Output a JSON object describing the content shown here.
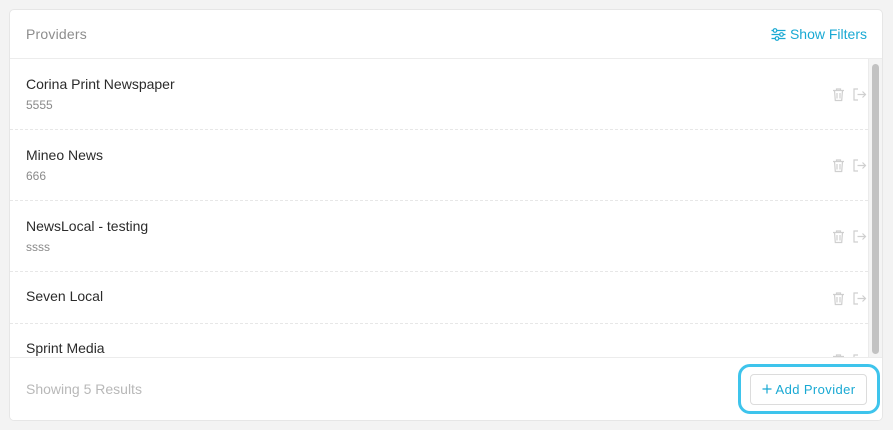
{
  "panel": {
    "title": "Providers",
    "filters_label": "Show Filters",
    "filters_icon": "sliders-icon"
  },
  "providers": [
    {
      "name": "Corina Print Newspaper",
      "sub": "5555"
    },
    {
      "name": "Mineo News",
      "sub": "666"
    },
    {
      "name": "NewsLocal - testing",
      "sub": "ssss"
    },
    {
      "name": "Seven Local",
      "sub": ""
    },
    {
      "name": "Sprint Media",
      "sub": ""
    }
  ],
  "row_actions": {
    "delete_icon": "trash-icon",
    "open_icon": "sign-out-icon"
  },
  "footer": {
    "results_text": "Showing 5 Results",
    "add_label": "Add Provider"
  },
  "colors": {
    "accent": "#19a9d3",
    "highlight_ring": "#3ec4ec",
    "muted_icon": "#cfcfcf"
  }
}
